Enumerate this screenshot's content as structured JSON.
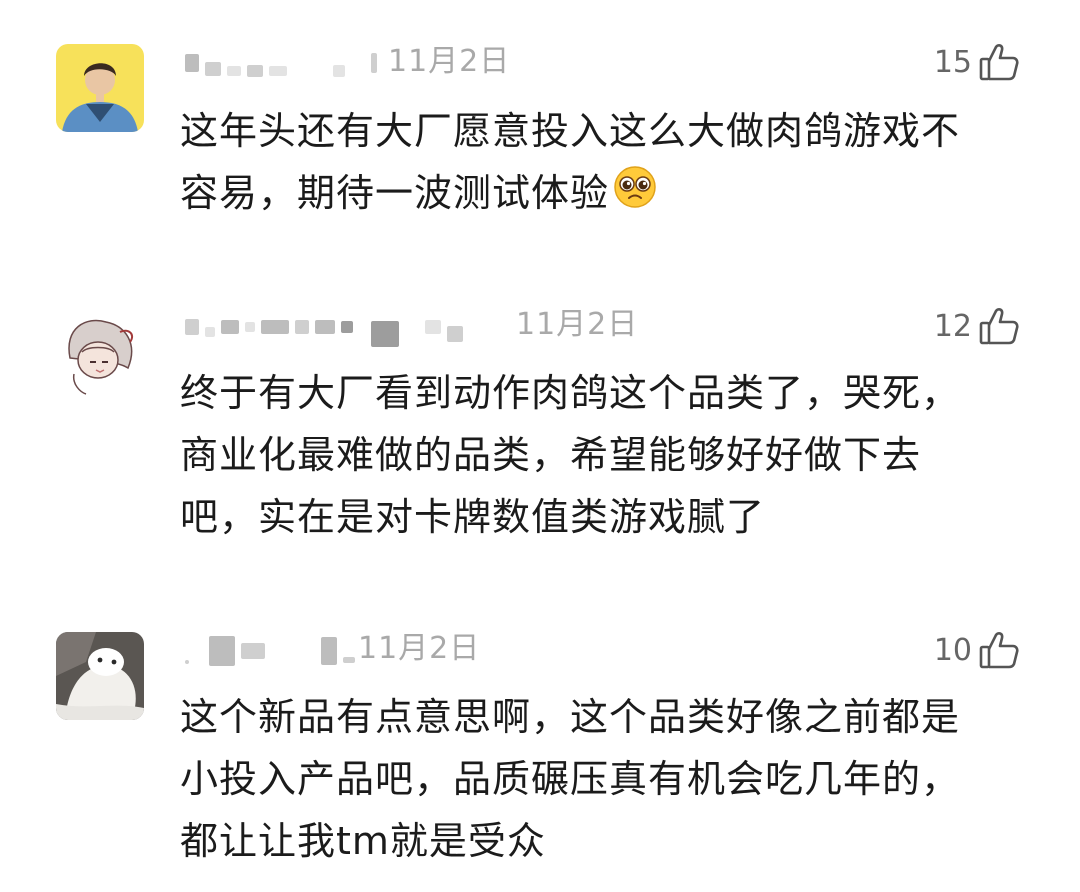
{
  "comments": [
    {
      "date": "11月2日",
      "likes": "15",
      "lines": [
        "这年头还有大厂愿意投入这么大做肉鸽游戏不",
        "容易，期待一波测试体验"
      ],
      "emoji": "pleading-face-emoji"
    },
    {
      "date": "11月2日",
      "likes": "12",
      "lines": [
        "终于有大厂看到动作肉鸽这个品类了，哭死，",
        "商业化最难做的品类，希望能够好好做下去",
        "吧，实在是对卡牌数值类游戏腻了"
      ]
    },
    {
      "date": "11月2日",
      "likes": "10",
      "lines": [
        "这个新品有点意思啊，这个品类好像之前都是",
        "小投入产品吧，品质碾压真有机会吃几年的，",
        "都让让我tm就是受众"
      ]
    }
  ],
  "icons": {
    "like": "thumbs-up-outline-icon"
  },
  "colors": {
    "date": "#a9a9a9",
    "like_count": "#666666",
    "text": "#1b1b1b",
    "avatar1_bg": "#f7e15a"
  }
}
